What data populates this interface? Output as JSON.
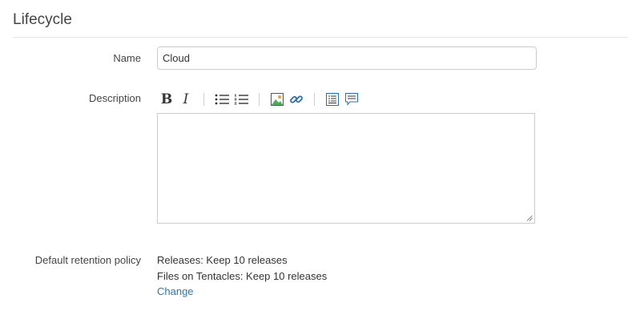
{
  "section": {
    "title": "Lifecycle"
  },
  "form": {
    "name_label": "Name",
    "name_value": "Cloud",
    "description_label": "Description",
    "description_value": "",
    "retention_label": "Default retention policy",
    "retention_releases": "Releases: Keep 10 releases",
    "retention_tentacles": "Files on Tentacles: Keep 10 releases",
    "change_link": "Change"
  },
  "toolbar": {
    "bold_glyph": "B",
    "italic_glyph": "I",
    "buttons": [
      "bold",
      "italic",
      "bulleted-list",
      "numbered-list",
      "image",
      "link",
      "preview",
      "comment"
    ]
  },
  "colors": {
    "link": "#2a7ab8",
    "text": "#333333",
    "label": "#444444",
    "border": "#cccccc",
    "icon_blue": "#2a6fb0"
  }
}
